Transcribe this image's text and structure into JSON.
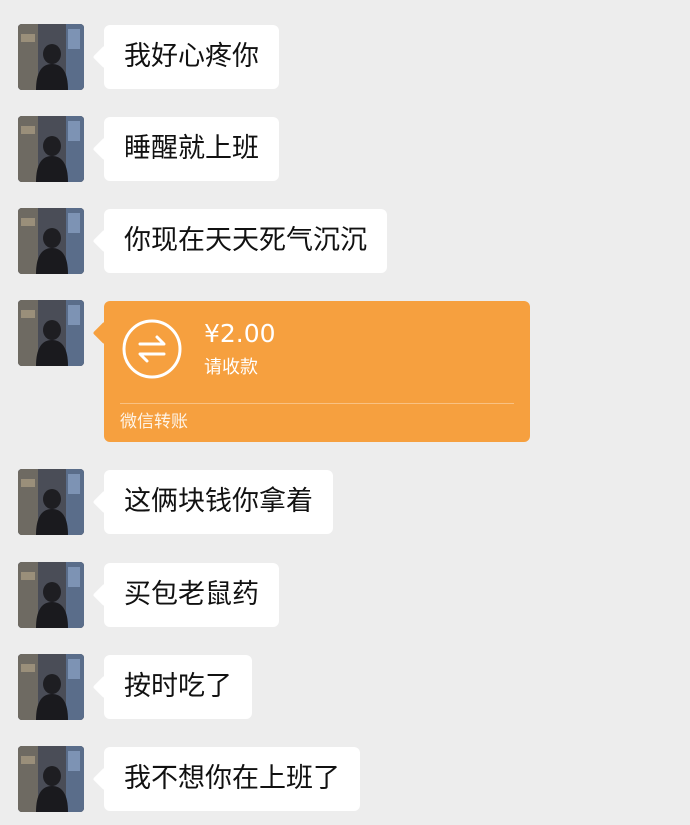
{
  "messages": [
    {
      "type": "text",
      "text": "我好心疼你"
    },
    {
      "type": "text",
      "text": "睡醒就上班"
    },
    {
      "type": "text",
      "text": "你现在天天死气沉沉"
    },
    {
      "type": "transfer",
      "amount": "¥2.00",
      "status": "请收款",
      "footer": "微信转账"
    },
    {
      "type": "text",
      "text": "这俩块钱你拿着"
    },
    {
      "type": "text",
      "text": "买包老鼠药"
    },
    {
      "type": "text",
      "text": "按时吃了"
    },
    {
      "type": "text",
      "text": "我不想你在上班了"
    }
  ],
  "colors": {
    "background": "#ededed",
    "bubble": "#ffffff",
    "transfer": "#f6a03f"
  },
  "icons": {
    "transfer": "transfer-arrows-icon",
    "avatar": "avatar"
  }
}
